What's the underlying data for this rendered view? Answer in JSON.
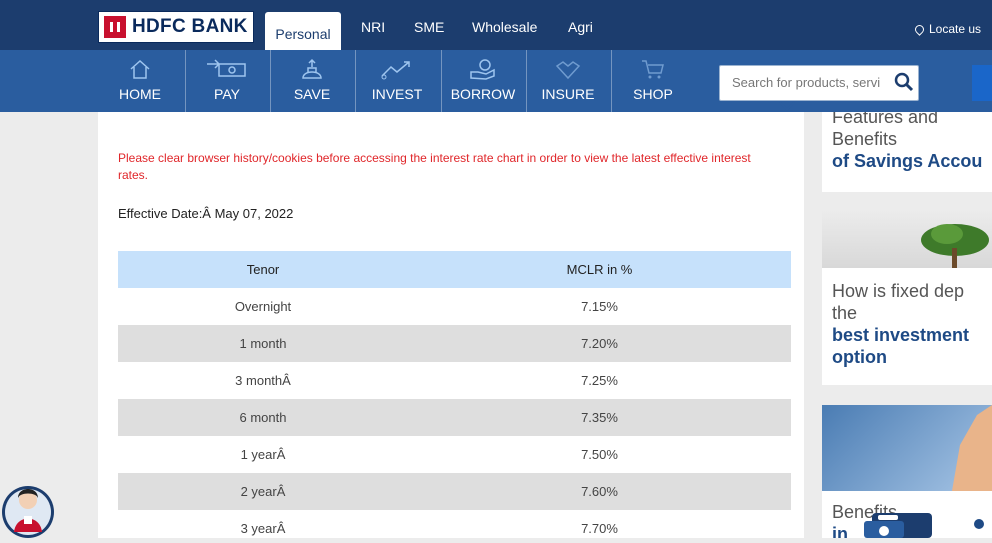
{
  "header": {
    "bank_name": "HDFC BANK",
    "tabs": [
      {
        "label": "Personal",
        "active": true
      },
      {
        "label": "NRI"
      },
      {
        "label": "SME"
      },
      {
        "label": "Wholesale"
      },
      {
        "label": "Agri"
      }
    ],
    "locate_label": "Locate us"
  },
  "nav": {
    "items": [
      {
        "label": "HOME",
        "icon": "home-icon"
      },
      {
        "label": "PAY",
        "icon": "pay-icon"
      },
      {
        "label": "SAVE",
        "icon": "save-icon"
      },
      {
        "label": "INVEST",
        "icon": "invest-icon"
      },
      {
        "label": "BORROW",
        "icon": "borrow-icon"
      },
      {
        "label": "INSURE",
        "icon": "insure-icon"
      },
      {
        "label": "SHOP",
        "icon": "shop-icon"
      }
    ],
    "search_placeholder": "Search for products, servi"
  },
  "modal": {
    "notice": "Please clear browser history/cookies before accessing the interest rate chart in order to view the latest effective interest rates.",
    "effective_date": "Effective Date:Â  May 07, 2022",
    "table": {
      "headers": [
        "Tenor",
        "MCLR in %"
      ],
      "rows": [
        {
          "tenor": "Overnight",
          "rate": "7.15%"
        },
        {
          "tenor": "1 month",
          "rate": "7.20%"
        },
        {
          "tenor": "3 monthÂ",
          "rate": "7.25%"
        },
        {
          "tenor": "6 month",
          "rate": "7.35%"
        },
        {
          "tenor": "1 yearÂ",
          "rate": "7.50%"
        },
        {
          "tenor": "2 yearÂ",
          "rate": "7.60%"
        },
        {
          "tenor": "3 yearÂ",
          "rate": "7.70%"
        }
      ]
    }
  },
  "sidebar": {
    "card1": {
      "line1": "Features and",
      "line2": "Benefits",
      "line3": "of Savings Accou"
    },
    "card2": {
      "line1": "How is fixed dep",
      "line2": "the",
      "line3": "best investment",
      "line4": "option"
    },
    "card3": {
      "line1": "Benefits",
      "line2": "in"
    }
  },
  "colors": {
    "header": "#1c3d6e",
    "nav": "#2a5d9f",
    "table_header": "#c6e1fb",
    "notice": "#e0262a"
  }
}
